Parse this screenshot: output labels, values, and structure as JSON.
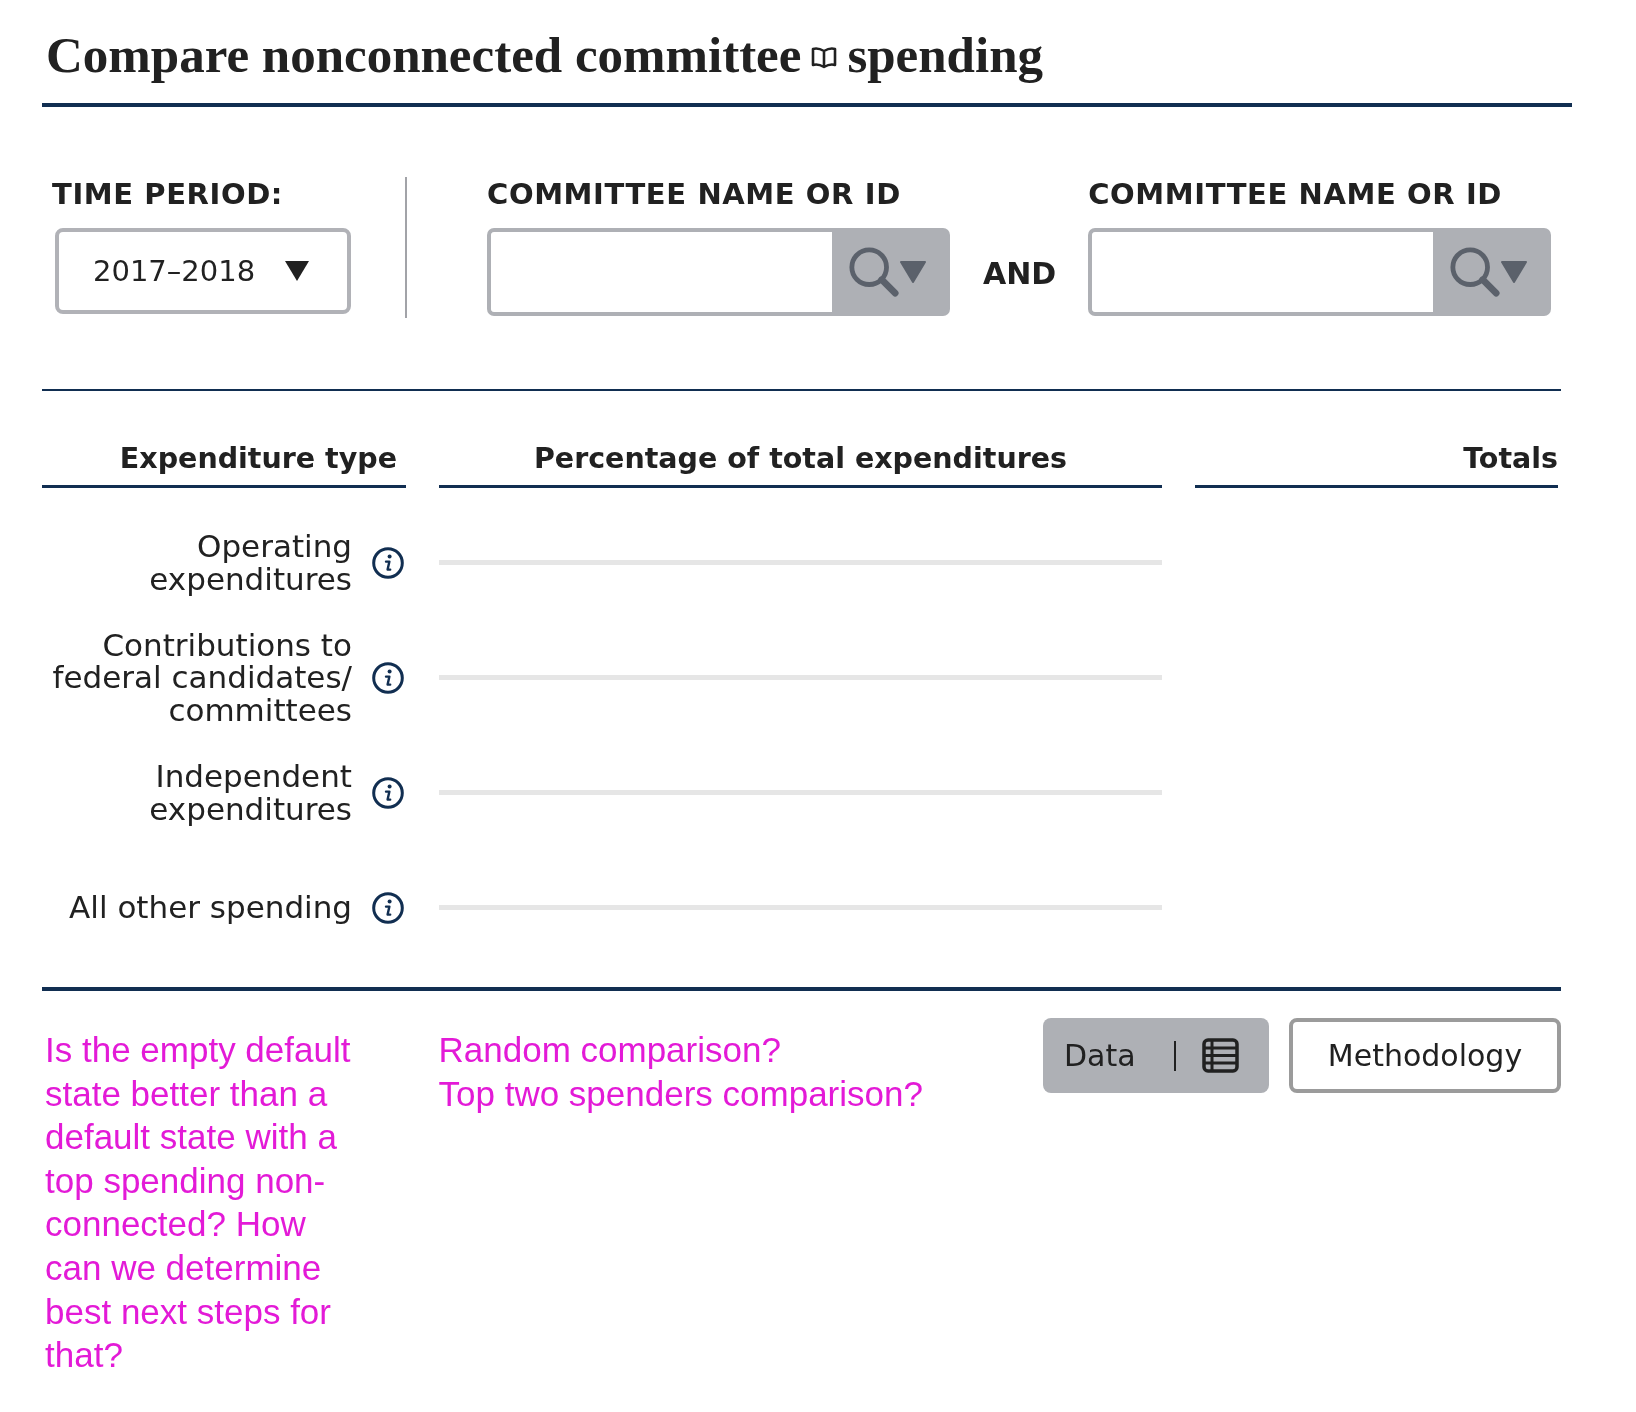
{
  "title": {
    "lead": "Compare nonconnected committee",
    "tail": "spending"
  },
  "filters": {
    "time_period": {
      "label": "TIME PERIOD:",
      "value": "2017–2018"
    },
    "conjunction": "AND",
    "committee_fields": [
      {
        "label": "COMMITTEE NAME OR ID"
      },
      {
        "label": "COMMITTEE NAME OR ID"
      }
    ]
  },
  "table": {
    "columns": [
      "Expenditure type",
      "Percentage of total expenditures",
      "Totals"
    ],
    "rows": [
      {
        "label": "Operating expenditures"
      },
      {
        "label": "Contributions to federal candidates/ committees"
      },
      {
        "label": "Independent expenditures"
      },
      {
        "label": "All other spending"
      }
    ]
  },
  "notes": {
    "question": "Is the empty default state better than a default state with a top spending non-connected? How can we determine best next steps for that?",
    "options": [
      "Random comparison?",
      "Top two spenders comparison?"
    ]
  },
  "buttons": [
    {
      "kind": "data",
      "label": "Data"
    },
    {
      "kind": "methodology",
      "label": "Methodology"
    }
  ]
}
